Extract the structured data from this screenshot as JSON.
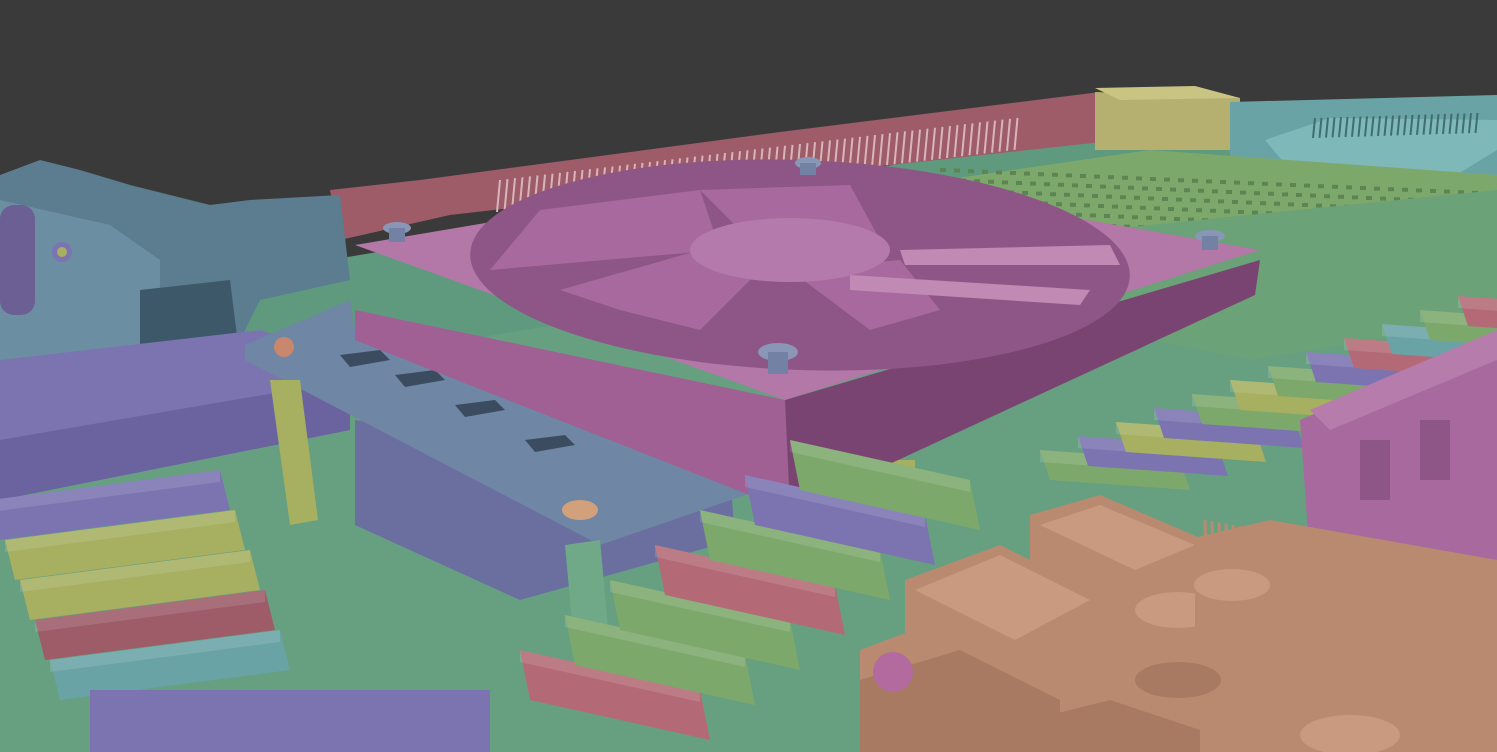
{
  "viewport": {
    "background": "#3a3a3a"
  },
  "palette": {
    "board_green": "#5f9a7e",
    "board_green_light": "#6fa987",
    "fan_pink": "#a86a9e",
    "fan_pink_dark": "#7a4472",
    "fan_pink_side": "#8e5686",
    "plate_blue": "#6f86a4",
    "plate_blue_dark": "#55677f",
    "heatsink_green": "#7da86c",
    "rail_red": "#9d5c68",
    "olive": "#aaa86c",
    "teal": "#69a3a5",
    "slate": "#5c7c90",
    "lilac": "#7b74b1",
    "copper": "#b98a6f",
    "copper_dark": "#8f6a55",
    "screw": "#8a96b6",
    "yellow_green": "#a6b060",
    "rose": "#b36a76"
  },
  "objects": [
    {
      "name": "ground-plane"
    },
    {
      "name": "circuit-board"
    },
    {
      "name": "fan-shroud"
    },
    {
      "name": "fan-blades"
    },
    {
      "name": "mounting-plate"
    },
    {
      "name": "heatsink-grid"
    },
    {
      "name": "ribbon-connector"
    },
    {
      "name": "io-bracket"
    },
    {
      "name": "usb-ports"
    },
    {
      "name": "capacitor"
    },
    {
      "name": "ram-clips"
    }
  ]
}
